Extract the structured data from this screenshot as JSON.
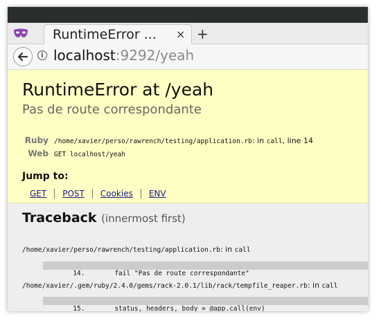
{
  "browser": {
    "tab_title": "RuntimeError ...",
    "tab_close": "×",
    "new_tab": "+",
    "url_host": "localhost",
    "url_rest": ":9292/yeah"
  },
  "error": {
    "title": "RuntimeError at /yeah",
    "message": "Pas de route correspondante",
    "ruby_label": "Ruby",
    "ruby_file": "/home/xavier/perso/rawrench/testing/application.rb",
    "ruby_in": ": in ",
    "ruby_method": "call",
    "ruby_line": ", line 14",
    "web_label": "Web",
    "web_value": "GET localhost/yeah"
  },
  "jump": {
    "title": "Jump to:",
    "links": [
      "GET",
      "POST",
      "Cookies",
      "ENV"
    ]
  },
  "traceback": {
    "title": "Traceback",
    "subtitle": "(innermost first)",
    "frames": [
      {
        "path": "/home/xavier/perso/rawrench/testing/application.rb",
        "in": ": in ",
        "method": "call",
        "line_no": "14.",
        "code": "fail \"Pas de route correspondante\""
      },
      {
        "path": "/home/xavier/.gem/ruby/2.4.0/gems/rack-2.0.1/lib/rack/tempfile_reaper.rb",
        "in": ": in ",
        "method": "call",
        "line_no": "15.",
        "code": "status, headers, body = @app.call(env)"
      }
    ]
  }
}
